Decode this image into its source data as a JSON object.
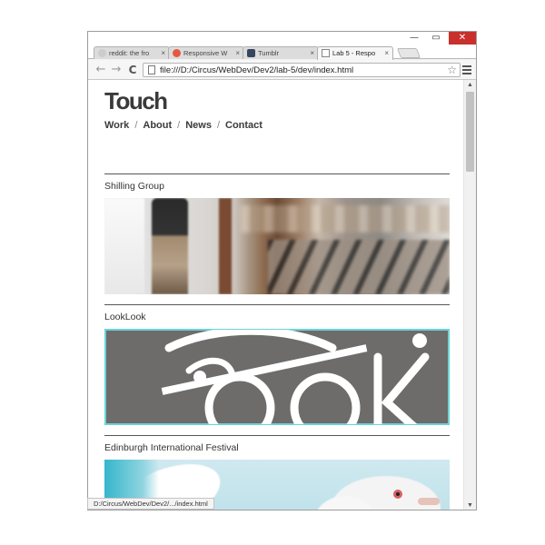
{
  "window": {
    "controls": {
      "minimize": "—",
      "maximize": "▭",
      "close": "✕"
    }
  },
  "tabs": [
    {
      "label": "reddit: the fro",
      "favicon_color": "#cccccc",
      "active": false
    },
    {
      "label": "Responsive W",
      "favicon_color": "#e8573f",
      "active": false
    },
    {
      "label": "Tumblr",
      "favicon_color": "#36465d",
      "active": false
    },
    {
      "label": "Lab 5 - Respo",
      "favicon_color": "#ffffff",
      "active": true
    }
  ],
  "tab_close_glyph": "×",
  "toolbar": {
    "back_glyph": "←",
    "forward_glyph": "→",
    "reload_glyph": "C",
    "url": "file:///D:/Circus/WebDev/Dev2/lab-5/dev/index.html",
    "star_glyph": "☆"
  },
  "page": {
    "logo": "Touch",
    "nav": [
      {
        "label": "Work"
      },
      {
        "label": "About"
      },
      {
        "label": "News"
      },
      {
        "label": "Contact"
      }
    ],
    "nav_separator": "/",
    "projects": [
      {
        "title": "Shilling Group"
      },
      {
        "title": "LookLook"
      },
      {
        "title": "Edinburgh International Festival"
      }
    ]
  },
  "status": {
    "text": "D:/Circus/WebDev/Dev2/.../index.html"
  },
  "scrollbar": {
    "up_glyph": "▲",
    "down_glyph": "▼"
  },
  "colors": {
    "close_button": "#c9302c",
    "highlight_border": "#6ad3d8",
    "text": "#3a3a3a"
  }
}
